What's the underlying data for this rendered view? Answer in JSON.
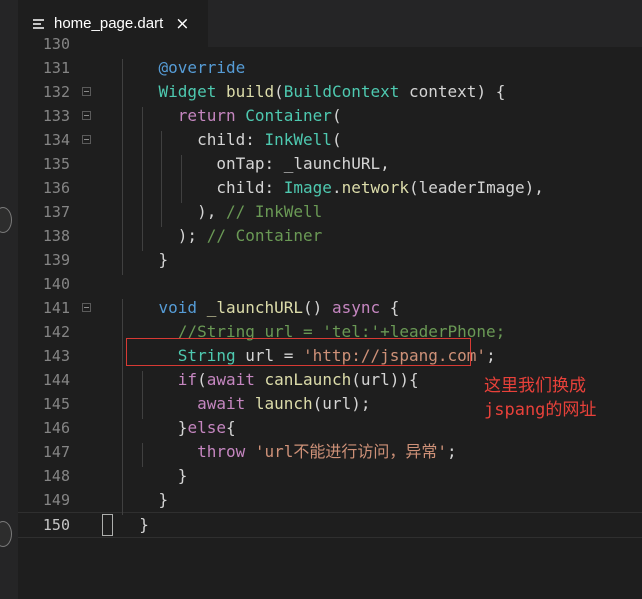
{
  "tab": {
    "filename": "home_page.dart",
    "close_glyph": "×",
    "icon": "file-lines-icon"
  },
  "editor": {
    "partial_top_line_number": "130",
    "lines": [
      {
        "num": "131",
        "fold": false,
        "tokens": [
          {
            "t": "    "
          },
          {
            "t": "@override",
            "c": "t-kw"
          }
        ]
      },
      {
        "num": "132",
        "fold": true,
        "tokens": [
          {
            "t": "    "
          },
          {
            "t": "Widget",
            "c": "t-type"
          },
          {
            "t": " "
          },
          {
            "t": "build",
            "c": "t-fn"
          },
          {
            "t": "("
          },
          {
            "t": "BuildContext",
            "c": "t-type"
          },
          {
            "t": " context) {"
          }
        ]
      },
      {
        "num": "133",
        "fold": true,
        "tokens": [
          {
            "t": "      "
          },
          {
            "t": "return",
            "c": "t-ctrl"
          },
          {
            "t": " "
          },
          {
            "t": "Container",
            "c": "t-type"
          },
          {
            "t": "("
          }
        ]
      },
      {
        "num": "134",
        "fold": true,
        "tokens": [
          {
            "t": "        child: "
          },
          {
            "t": "InkWell",
            "c": "t-type"
          },
          {
            "t": "("
          }
        ]
      },
      {
        "num": "135",
        "fold": false,
        "tokens": [
          {
            "t": "          onTap: _launchURL,"
          }
        ]
      },
      {
        "num": "136",
        "fold": false,
        "tokens": [
          {
            "t": "          child: "
          },
          {
            "t": "Image",
            "c": "t-type"
          },
          {
            "t": "."
          },
          {
            "t": "network",
            "c": "t-fn"
          },
          {
            "t": "(leaderImage),"
          }
        ]
      },
      {
        "num": "137",
        "fold": false,
        "tokens": [
          {
            "t": "        ), "
          },
          {
            "t": "// InkWell",
            "c": "t-cmt"
          }
        ]
      },
      {
        "num": "138",
        "fold": false,
        "tokens": [
          {
            "t": "      ); "
          },
          {
            "t": "// Container",
            "c": "t-cmt"
          }
        ]
      },
      {
        "num": "139",
        "fold": false,
        "tokens": [
          {
            "t": "    }"
          }
        ]
      },
      {
        "num": "140",
        "fold": false,
        "tokens": []
      },
      {
        "num": "141",
        "fold": true,
        "tokens": [
          {
            "t": "    "
          },
          {
            "t": "void",
            "c": "t-kw"
          },
          {
            "t": " "
          },
          {
            "t": "_launchURL",
            "c": "t-fn"
          },
          {
            "t": "() "
          },
          {
            "t": "async",
            "c": "t-ctrl"
          },
          {
            "t": " {"
          }
        ]
      },
      {
        "num": "142",
        "fold": false,
        "tokens": [
          {
            "t": "      "
          },
          {
            "t": "//String url = 'tel:'+leaderPhone;",
            "c": "t-cmt"
          }
        ]
      },
      {
        "num": "143",
        "fold": false,
        "tokens": [
          {
            "t": "      "
          },
          {
            "t": "String",
            "c": "t-type"
          },
          {
            "t": " url = "
          },
          {
            "t": "'http://jspang.com'",
            "c": "t-str"
          },
          {
            "t": ";"
          }
        ]
      },
      {
        "num": "144",
        "fold": false,
        "tokens": [
          {
            "t": "      "
          },
          {
            "t": "if",
            "c": "t-ctrl"
          },
          {
            "t": "("
          },
          {
            "t": "await",
            "c": "t-ctrl"
          },
          {
            "t": " "
          },
          {
            "t": "canLaunch",
            "c": "t-fn"
          },
          {
            "t": "(url)){"
          }
        ]
      },
      {
        "num": "145",
        "fold": false,
        "tokens": [
          {
            "t": "        "
          },
          {
            "t": "await",
            "c": "t-ctrl"
          },
          {
            "t": " "
          },
          {
            "t": "launch",
            "c": "t-fn"
          },
          {
            "t": "(url);"
          }
        ]
      },
      {
        "num": "146",
        "fold": false,
        "tokens": [
          {
            "t": "      }"
          },
          {
            "t": "else",
            "c": "t-ctrl"
          },
          {
            "t": "{"
          }
        ]
      },
      {
        "num": "147",
        "fold": false,
        "tokens": [
          {
            "t": "        "
          },
          {
            "t": "throw",
            "c": "t-ctrl"
          },
          {
            "t": " "
          },
          {
            "t": "'url不能进行访问，异常'",
            "c": "t-str"
          },
          {
            "t": ";"
          }
        ]
      },
      {
        "num": "148",
        "fold": false,
        "tokens": [
          {
            "t": "      }"
          }
        ]
      },
      {
        "num": "149",
        "fold": false,
        "tokens": [
          {
            "t": "    }"
          }
        ]
      },
      {
        "num": "150",
        "fold": false,
        "current": true,
        "tokens": [
          {
            "t": "  }"
          }
        ]
      }
    ]
  },
  "annotation": {
    "line1": "这里我们换成",
    "line2": "jspang的网址"
  },
  "colors": {
    "background": "#1e1e1e",
    "highlight_box": "#d83a34",
    "annotation_text": "#e8413a"
  }
}
